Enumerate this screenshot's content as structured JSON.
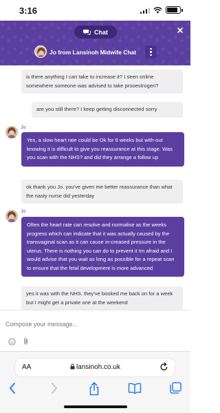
{
  "status": {
    "time": "3:16",
    "battery_level": 0.85
  },
  "header": {
    "chat_label": "Chat",
    "agent_title": "Jo from Lansinoh Midwife Chat"
  },
  "messages": [
    {
      "from": "user",
      "text": "is there anything I can take to increase it? I seen online somewhere someone was advised to take prooestrogen?"
    },
    {
      "from": "user",
      "text": "are you still there? I keep getting disconnected sorry"
    },
    {
      "from": "agent",
      "sender": "Jo",
      "text": "Yes, a slow heart rate could be Ok for 6 weeks but with-out knowing it is difficult to give you reassurance at this stage. Was you scan with the NHS? and did they arrange a follow up"
    },
    {
      "from": "user",
      "text": "ok thank you Jo. you've given me better reassurance than what the nasty nurse did yesterday"
    },
    {
      "from": "agent",
      "sender": "Jo",
      "text": "Often the heart rate can resolve and normalise as the weeks progress which can indicate that it was actually caused by the transvaginal scan as it can cause in-creased pressure in the uterus. There is nothing you can do to prevent it Im afraid and I would advise that you wait as long as possible for a repeat scan to ensure that the fetal development is more advanced"
    },
    {
      "from": "user",
      "text": "yes it was with the NHS. they've booked me back on for a week but I might get a private one at the weekend"
    }
  ],
  "compose": {
    "placeholder": "Compose your message..."
  },
  "browser": {
    "aa_label": "AA",
    "url": "lansinoh.co.uk"
  },
  "colors": {
    "brand_purple": "#5b3fa0",
    "pill_dark": "#3d2777",
    "ios_blue": "#2f7cf6"
  }
}
